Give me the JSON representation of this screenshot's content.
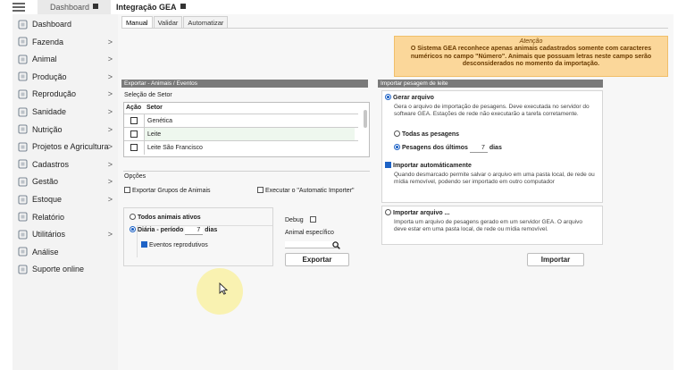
{
  "tabs": {
    "dashboard": "Dashboard",
    "integration": "Integração GEA"
  },
  "sidebar": {
    "items": [
      {
        "label": "Dashboard",
        "icon": "dashboard-grid-icon",
        "chevron": ""
      },
      {
        "label": "Fazenda",
        "icon": "barn-icon",
        "chevron": ">"
      },
      {
        "label": "Animal",
        "icon": "cow-icon",
        "chevron": ">"
      },
      {
        "label": "Produção",
        "icon": "gear-icon",
        "chevron": ">"
      },
      {
        "label": "Reprodução",
        "icon": "reproduction-icon",
        "chevron": ">"
      },
      {
        "label": "Sanidade",
        "icon": "health-cross-icon",
        "chevron": ">"
      },
      {
        "label": "Nutrição",
        "icon": "nutrition-icon",
        "chevron": ">"
      },
      {
        "label": "Projetos e Agricultura",
        "icon": "leaf-icon",
        "chevron": ">"
      },
      {
        "label": "Cadastros",
        "icon": "list-icon",
        "chevron": ">"
      },
      {
        "label": "Gestão",
        "icon": "money-icon",
        "chevron": ">"
      },
      {
        "label": "Estoque",
        "icon": "stock-box-icon",
        "chevron": ">"
      },
      {
        "label": "Relatório",
        "icon": "report-icon",
        "chevron": ""
      },
      {
        "label": "Utilitários",
        "icon": "tools-icon",
        "chevron": ">"
      },
      {
        "label": "Análise",
        "icon": "analysis-icon",
        "chevron": ""
      },
      {
        "label": "Suporte online",
        "icon": "support-icon",
        "chevron": ""
      }
    ]
  },
  "subtabs": [
    "Manual",
    "Validar",
    "Automatizar"
  ],
  "warning": {
    "title": "Atenção",
    "body": "O Sistema GEA reconhece apenas animais cadastrados somente com caracteres numéricos no campo \"Número\". Animais que possuam letras neste campo serão desconsiderados no momento da importação."
  },
  "export": {
    "header": "Exportar - Animais / Eventos",
    "sector_title": "Seleção de Setor",
    "col_action": "Ação",
    "col_sector": "Setor",
    "sectors": [
      "Genética",
      "Leite",
      "Leite São Francisco"
    ],
    "options_title": "Opções",
    "opt_groups": "Exportar Grupos de Animais",
    "opt_importer": "Executar o \"Automatic Importer\"",
    "all_animals": "Todos animais ativos",
    "daily": "Diária - período",
    "daily_days": "7",
    "days_label": "dias",
    "repro_events": "Eventos reprodutivos",
    "debug": "Debug",
    "specific_animal": "Animal específico",
    "button": "Exportar"
  },
  "import": {
    "header": "Importar pesagem de leite",
    "gen_file": "Gerar arquivo",
    "gen_desc": "Gera o arquivo de importação de pesagens. Deve executada no servidor do software GEA. Estações de rede não executarão a tarefa corretamente.",
    "all_weighings": "Todas as pesagens",
    "last_weighings": "Pesagens dos últimos",
    "last_days": "7",
    "days_label": "dias",
    "auto_import": "Importar automáticamente",
    "auto_desc": "Quando desmarcado permite salvar o arquivo em uma pasta local, de rede ou mídia removível, podendo ser importado em outro computador",
    "import_file": "Importar arquivo ...",
    "import_desc": "Importa um arquivo de pesagens gerado em um servidor GEA. O arquivo deve estar em uma pasta local, de rede ou mídia removível.",
    "button": "Importar"
  },
  "colors": {
    "sidebar_bg": "#f3f3f3",
    "panel_header": "#7a7a7a",
    "warning_bg": "#fbd79a",
    "accent": "#1e63c6"
  }
}
